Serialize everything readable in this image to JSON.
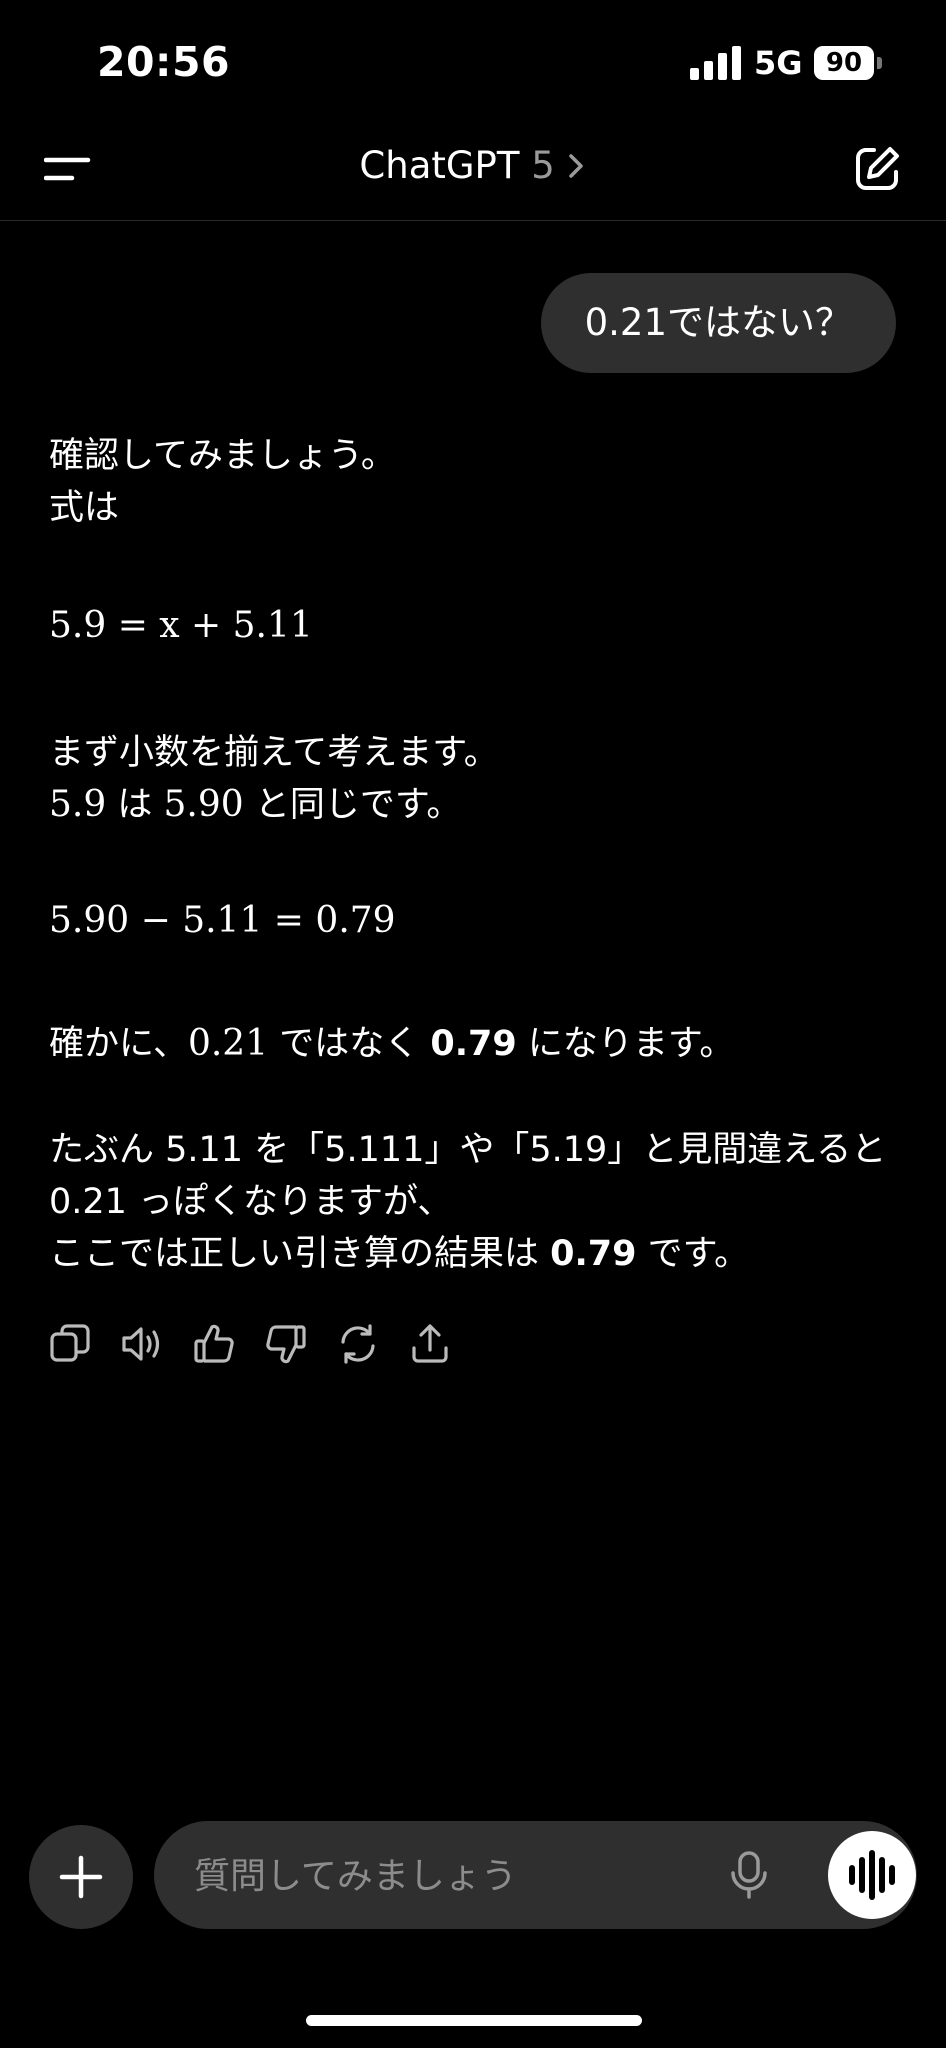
{
  "status_bar": {
    "time": "20:56",
    "network": "5G",
    "battery": "90"
  },
  "header": {
    "title": "ChatGPT",
    "model": "5",
    "menu_icon": "menu-icon",
    "edit_icon": "new-chat-icon"
  },
  "user_message": {
    "text": "0.21ではない？"
  },
  "assistant_message": {
    "line1": "確認してみましょう。",
    "line2": "式は",
    "eq1": "5.9 = x + 5.11",
    "line3": "まず小数を揃えて考えます。",
    "line4_a": "5.9",
    "line4_b": " は ",
    "line4_c": "5.90",
    "line4_d": " と同じです。",
    "eq2": "5.90 − 5.11 = 0.79",
    "line5_a": "確かに、",
    "line5_b": "0.21",
    "line5_c": " ではなく ",
    "line5_d": "0.79",
    "line5_e": " になります。",
    "line6": "たぶん 5.11 を「5.111」や「5.19」と見間違えると",
    "line7": "0.21 っぽくなりますが、",
    "line8_a": "ここでは正しい引き算の結果は ",
    "line8_b": "0.79",
    "line8_c": " です。"
  },
  "actions": [
    "copy-icon",
    "read-aloud-icon",
    "thumbs-up-icon",
    "thumbs-down-icon",
    "regenerate-icon",
    "share-icon"
  ],
  "composer": {
    "placeholder": "質問してみましょう"
  }
}
